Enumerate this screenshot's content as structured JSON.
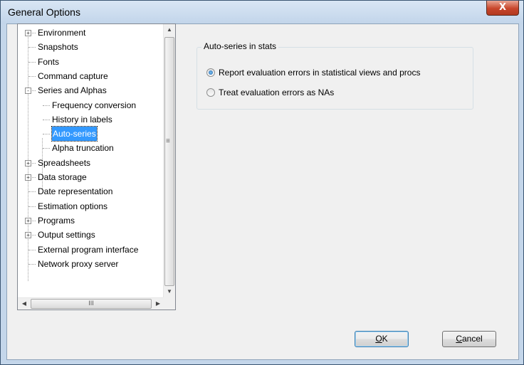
{
  "window": {
    "title": "General Options",
    "close_glyph": "X"
  },
  "tree": {
    "items": [
      {
        "label": "Environment",
        "expander": "+"
      },
      {
        "label": "Snapshots"
      },
      {
        "label": "Fonts"
      },
      {
        "label": "Command capture"
      },
      {
        "label": "Series and Alphas",
        "expander": "-"
      },
      {
        "label": "Frequency conversion"
      },
      {
        "label": "History in labels"
      },
      {
        "label": "Auto-series",
        "selected": true
      },
      {
        "label": "Alpha truncation"
      },
      {
        "label": "Spreadsheets",
        "expander": "+"
      },
      {
        "label": "Data storage",
        "expander": "+"
      },
      {
        "label": "Date representation"
      },
      {
        "label": "Estimation options"
      },
      {
        "label": "Programs",
        "expander": "+"
      },
      {
        "label": "Output settings",
        "expander": "+"
      },
      {
        "label": "External program interface"
      },
      {
        "label": "Network proxy server"
      }
    ],
    "scroll_up": "▲",
    "scroll_down": "▼",
    "scroll_left": "◀",
    "scroll_right": "▶",
    "hthumb_grip": "III",
    "vthumb_grip": "≡"
  },
  "group": {
    "legend": "Auto-series in stats",
    "options": [
      {
        "label": "Report evaluation errors in statistical views and procs",
        "checked": true
      },
      {
        "label": "Treat evaluation errors as NAs",
        "checked": false
      }
    ]
  },
  "buttons": {
    "ok": {
      "mnemonic": "O",
      "rest": "K"
    },
    "cancel": {
      "mnemonic": "C",
      "rest": "ancel"
    }
  },
  "colors": {
    "selection": "#3399ff",
    "close_button": "#c7462b",
    "titlebar": "#c2d5ea"
  }
}
